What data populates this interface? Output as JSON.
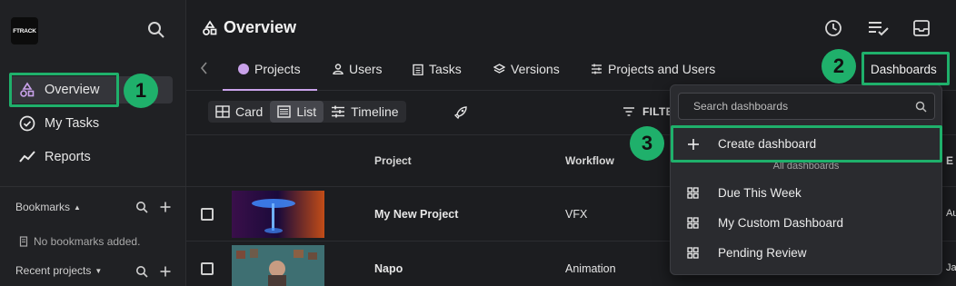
{
  "app": {
    "logo_text": "FTRACK"
  },
  "sidebar": {
    "items": [
      {
        "label": "Overview",
        "icon": "shapes-icon"
      },
      {
        "label": "My Tasks",
        "icon": "check-circle-icon"
      },
      {
        "label": "Reports",
        "icon": "trend-icon"
      }
    ],
    "bookmarks": {
      "title": "Bookmarks",
      "empty": "No bookmarks added."
    },
    "recent": {
      "title": "Recent projects"
    }
  },
  "header": {
    "title": "Overview"
  },
  "tabs": [
    {
      "label": "Projects",
      "active": true
    },
    {
      "label": "Users"
    },
    {
      "label": "Tasks"
    },
    {
      "label": "Versions"
    },
    {
      "label": "Projects and Users"
    }
  ],
  "dashboards_button": "Dashboards",
  "views": {
    "card": "Card",
    "list": "List",
    "timeline": "Timeline",
    "selected": "List"
  },
  "filter_label": "FILTE",
  "table": {
    "columns": [
      "Project",
      "Workflow"
    ],
    "col_cut": "E",
    "rows": [
      {
        "project": "My New Project",
        "workflow": "VFX",
        "cut": "Au"
      },
      {
        "project": "Napo",
        "workflow": "Animation",
        "cut": "Ja"
      }
    ]
  },
  "dropdown": {
    "search_placeholder": "Search dashboards",
    "create_label": "Create dashboard",
    "section_label": "All dashboards",
    "items": [
      "Due This Week",
      "My Custom Dashboard",
      "Pending Review"
    ]
  },
  "callouts": [
    "1",
    "2",
    "3"
  ],
  "colors": {
    "accent": "#c9a2ea",
    "highlight": "#1fb06b"
  }
}
